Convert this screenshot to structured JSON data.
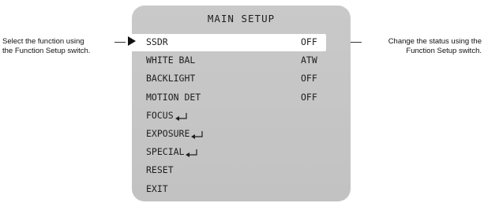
{
  "callouts": {
    "left": [
      "Select the function using",
      "the Function Setup switch."
    ],
    "right": [
      "Change the status using the",
      "Function Setup switch."
    ]
  },
  "menu": {
    "title": "MAIN SETUP",
    "items": [
      {
        "label": "SSDR",
        "value": "OFF",
        "selected": true,
        "submenu": false
      },
      {
        "label": "WHITE BAL",
        "value": "ATW",
        "selected": false,
        "submenu": false
      },
      {
        "label": "BACKLIGHT",
        "value": "OFF",
        "selected": false,
        "submenu": false
      },
      {
        "label": "MOTION DET",
        "value": "OFF",
        "selected": false,
        "submenu": false
      },
      {
        "label": "FOCUS",
        "value": "",
        "selected": false,
        "submenu": true
      },
      {
        "label": "EXPOSURE",
        "value": "",
        "selected": false,
        "submenu": true
      },
      {
        "label": "SPECIAL",
        "value": "",
        "selected": false,
        "submenu": true
      },
      {
        "label": "RESET",
        "value": "",
        "selected": false,
        "submenu": false
      },
      {
        "label": "EXIT",
        "value": "",
        "selected": false,
        "submenu": false
      }
    ]
  },
  "icons": {
    "pointer": "triangle-right-icon",
    "submenu": "enter-arrow-icon"
  }
}
